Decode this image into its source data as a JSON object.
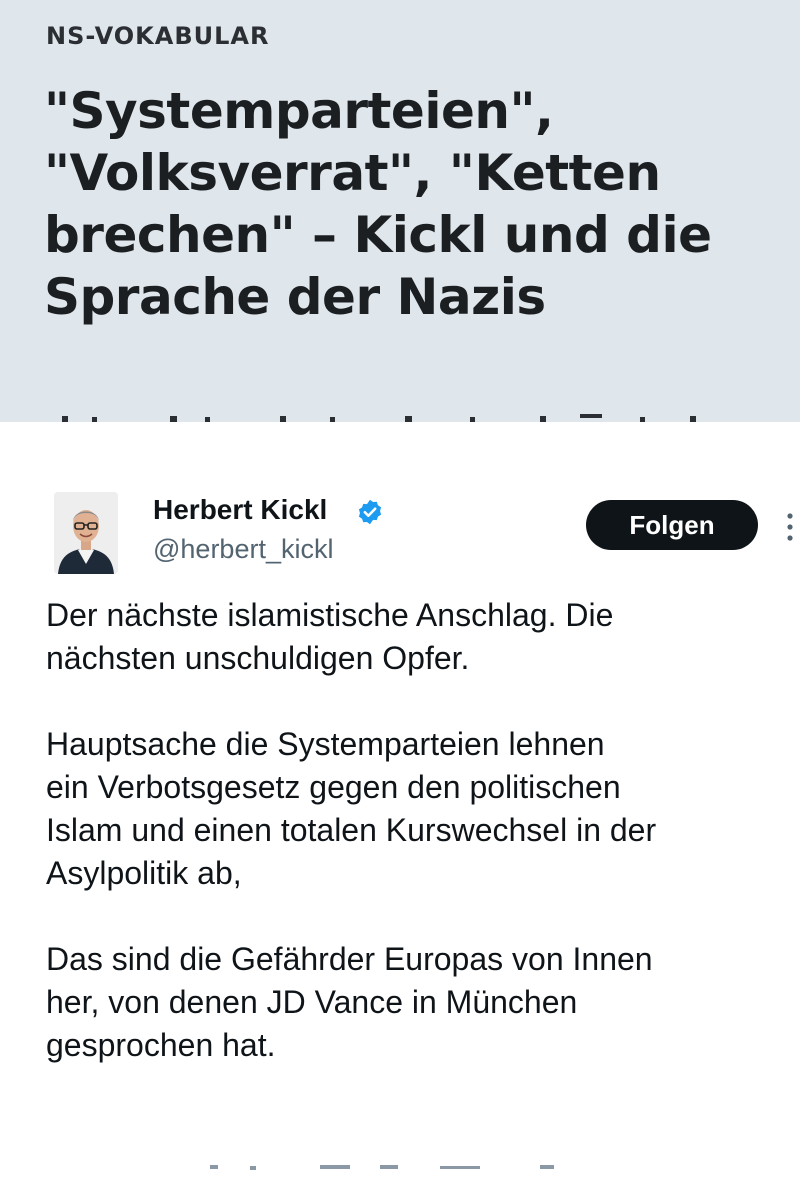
{
  "article": {
    "kicker": "NS-VOKABULAR",
    "headline_lines": [
      "\"Systemparteien\",",
      "\"Volksverrat\", \"Ketten",
      "brechen\" – Kickl und die",
      "Sprache der Nazis"
    ],
    "background_color": "#dfe6ec"
  },
  "tweet": {
    "display_name": "Herbert Kickl",
    "handle": "@herbert_kickl",
    "verified_icon": "verified-badge-icon",
    "follow_label": "Folgen",
    "more_icon": "more-options-icon",
    "paragraphs": [
      [
        "Der nächste islamistische Anschlag. Die",
        "nächsten unschuldigen Opfer."
      ],
      [
        "Hauptsache die Systemparteien lehnen",
        "ein Verbotsgesetz gegen den politischen",
        "Islam und einen totalen Kurswechsel in der",
        "Asylpolitik ab,"
      ],
      [
        "Das sind die Gefährder Europas von Innen",
        "her, von denen JD Vance in München",
        "gesprochen hat."
      ]
    ],
    "colors": {
      "text": "#0f1419",
      "muted": "#536471",
      "verified": "#1d9bf0",
      "button": "#0f1419"
    }
  }
}
